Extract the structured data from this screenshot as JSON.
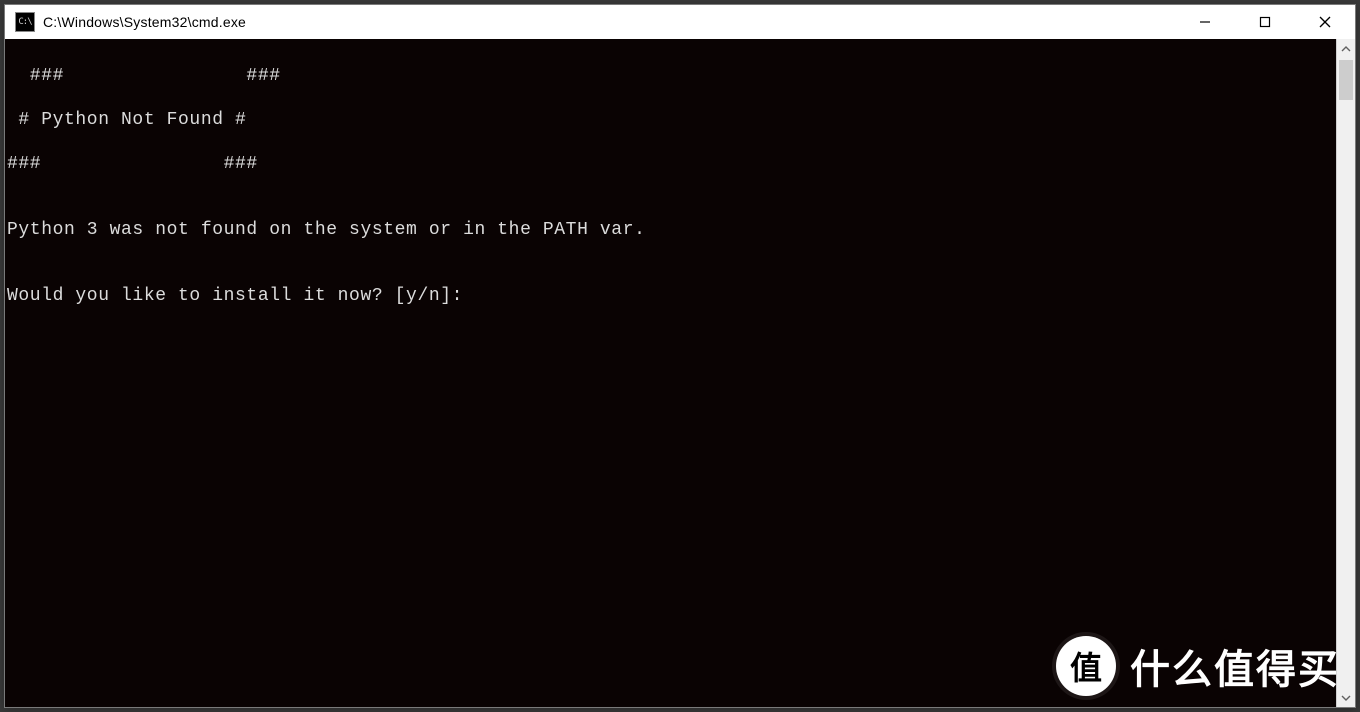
{
  "titlebar": {
    "icon_label": "C:\\",
    "title": "C:\\Windows\\System32\\cmd.exe"
  },
  "console": {
    "lines": [
      "  ###                ###",
      " # Python Not Found #",
      "###                ###",
      "",
      "Python 3 was not found on the system or in the PATH var.",
      "",
      "Would you like to install it now? [y/n]:"
    ]
  },
  "watermark": {
    "badge": "值",
    "text": "什么值得买"
  }
}
